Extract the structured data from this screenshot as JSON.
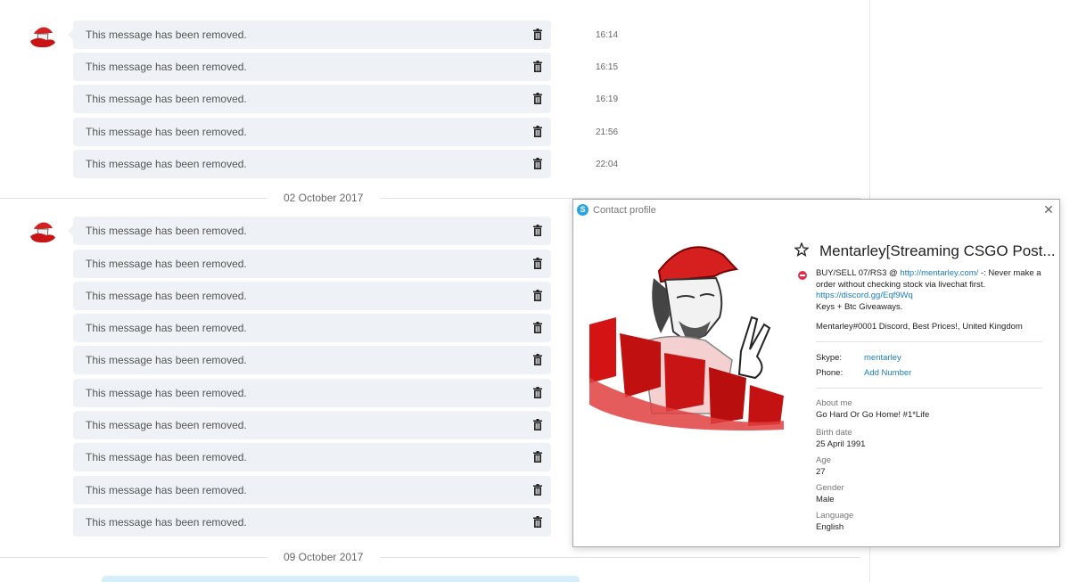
{
  "top_cut_text": "",
  "removed_text": "This message has been removed.",
  "group1": {
    "times": [
      "16:14",
      "16:15",
      "16:19",
      "21:56",
      "22:04"
    ]
  },
  "date1": "02 October 2017",
  "group2": {
    "count": 10
  },
  "date2": "09 October 2017",
  "profile": {
    "window_title": "Contact profile",
    "name": "Mentarley[Streaming CSGO Post...",
    "mood_prefix": "BUY/SELL 07/RS3 @ ",
    "mood_link": "http://mentarley.com/",
    "mood_suffix": " -: Never make a order without checking stock via livechat first.",
    "discord_link": "https://discord.gg/Eqf9Wq",
    "mood_line2": "Keys + Btc Giveaways.",
    "location": "Mentarley#0001 Discord, Best Prices!, United Kingdom",
    "skype_label": "Skype:",
    "skype_value": "mentarley",
    "phone_label": "Phone:",
    "phone_value": "Add Number",
    "about_label": "About me",
    "about_value": "Go Hard Or Go Home! #1*Life",
    "birth_label": "Birth date",
    "birth_value": "25 April 1991",
    "age_label": "Age",
    "age_value": "27",
    "gender_label": "Gender",
    "gender_value": "Male",
    "language_label": "Language",
    "language_value": "English"
  },
  "colors": {
    "bubble": "#eef1f6",
    "link": "#1a7cc4",
    "status_dnd": "#e0304e",
    "skype_blue": "#2aa3e4"
  }
}
